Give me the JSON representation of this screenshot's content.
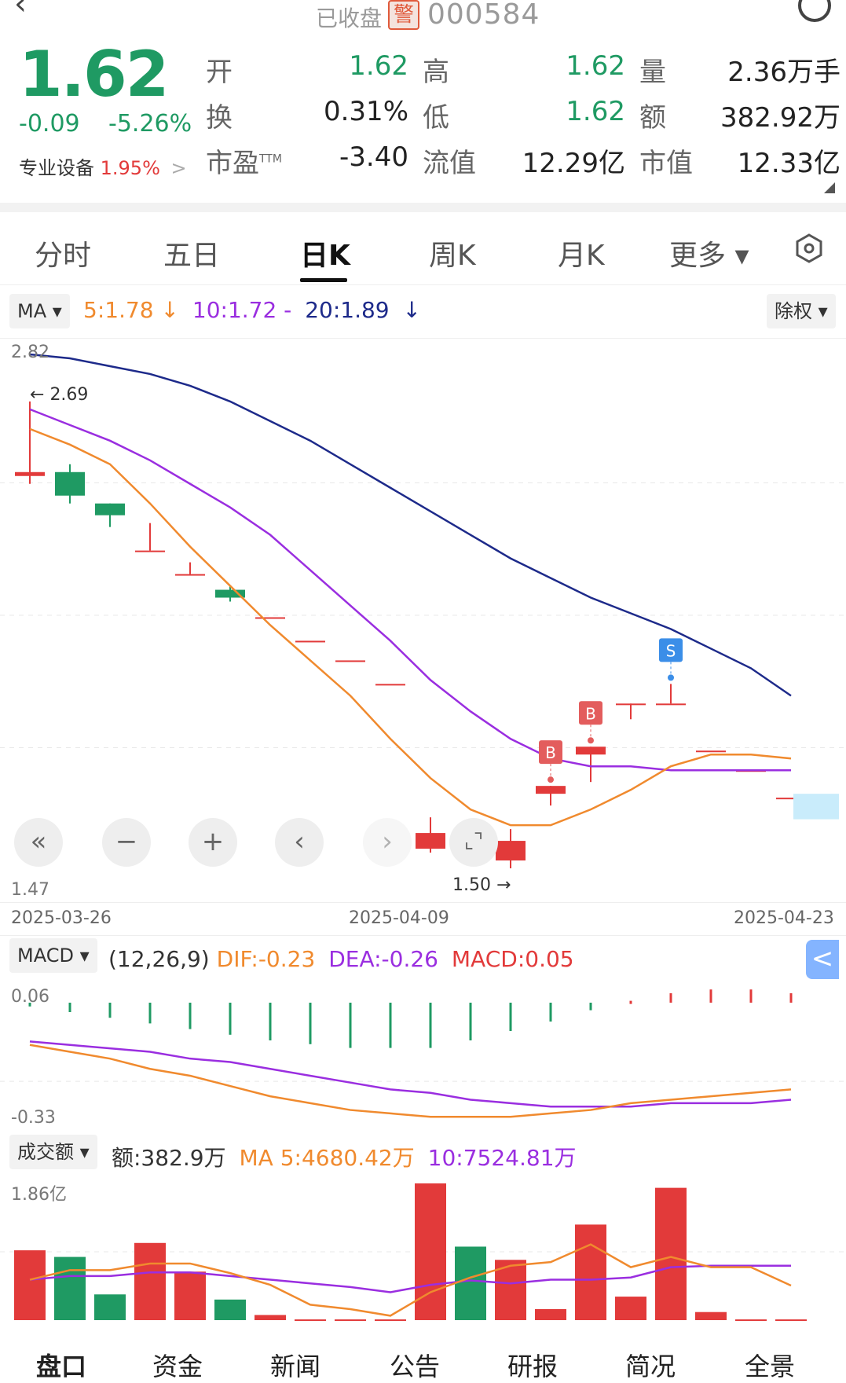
{
  "header": {
    "back_icon": "chevron-left-icon",
    "status": "已收盘",
    "warning_badge": "警",
    "code": "000584",
    "search_icon": "search-icon"
  },
  "quote": {
    "price": "1.62",
    "change": "-0.09",
    "change_pct": "-5.26%",
    "sector_label": "专业设备",
    "sector_pct": "1.95%",
    "sector_arrow": ">",
    "rows": [
      {
        "l1": "开",
        "v1": "1.62",
        "l2": "高",
        "v2": "1.62",
        "l3": "量",
        "v3": "2.36万手"
      },
      {
        "l1": "换",
        "v1": "0.31%",
        "l2": "低",
        "v2": "1.62",
        "l3": "额",
        "v3": "382.92万"
      },
      {
        "l1": "市盈",
        "sup": "TTM",
        "v1": "-3.40",
        "l2": "流值",
        "v2": "12.29亿",
        "l3": "市值",
        "v3": "12.33亿"
      }
    ]
  },
  "tabs": [
    "分时",
    "五日",
    "日K",
    "周K",
    "月K",
    "更多 ▾"
  ],
  "active_tab": "日K",
  "settings_icon": "hexagon-settings-icon",
  "ma": {
    "chip": "MA ▾",
    "ma5": "5:1.78",
    "ma5_arrow": "↓",
    "ma10": "10:1.72 -",
    "ma20": "20:1.89",
    "ma20_arrow": "↓",
    "adjust_chip": "除权 ▾"
  },
  "kline_axis": {
    "top": "2.82",
    "bottom": "1.47"
  },
  "annotations": {
    "high": "2.69",
    "low": "1.50"
  },
  "dates": {
    "start": "2025-03-26",
    "mid": "2025-04-09",
    "end": "2025-04-23"
  },
  "controls": {
    "first": "«",
    "zoom_out": "−",
    "zoom_in": "+",
    "prev": "‹",
    "next": "›"
  },
  "macd": {
    "chip": "MACD ▾",
    "params": "(12,26,9)",
    "dif": "DIF:-0.23",
    "dea": "DEA:-0.26",
    "macd": "MACD:0.05",
    "axis_top": "0.06",
    "axis_bottom": "-0.33",
    "side_toggle": "<"
  },
  "amount": {
    "chip": "成交额 ▾",
    "value": "额:382.9万",
    "ma5": "MA 5:4680.42万",
    "ma10": "10:7524.81万",
    "axis_top": "1.86亿"
  },
  "bottom_tabs": [
    "盘口",
    "资金",
    "新闻",
    "公告",
    "研报",
    "简况",
    "全景"
  ],
  "colors": {
    "up": "#e23a3a",
    "down": "#1f9a63",
    "ma5": "#f08a2e",
    "ma10": "#9a2ee0",
    "ma20": "#1d2a8a",
    "buy": "#e35d5d",
    "sell": "#3b8ee8"
  },
  "chart_data": {
    "type": "candlestick",
    "dates_shown": [
      "2025-03-26",
      "2025-04-09",
      "2025-04-23"
    ],
    "candles": [
      {
        "o": 2.5,
        "h": 2.69,
        "l": 2.48,
        "c": 2.51
      },
      {
        "o": 2.51,
        "h": 2.53,
        "l": 2.43,
        "c": 2.45
      },
      {
        "o": 2.43,
        "h": 2.42,
        "l": 2.37,
        "c": 2.4
      },
      {
        "o": 2.31,
        "h": 2.38,
        "l": 2.31,
        "c": 2.31
      },
      {
        "o": 2.25,
        "h": 2.28,
        "l": 2.25,
        "c": 2.25
      },
      {
        "o": 2.21,
        "h": 2.22,
        "l": 2.18,
        "c": 2.19
      },
      {
        "o": 2.14,
        "h": 2.14,
        "l": 2.14,
        "c": 2.14
      },
      {
        "o": 2.08,
        "h": 2.08,
        "l": 2.08,
        "c": 2.08
      },
      {
        "o": 2.03,
        "h": 2.03,
        "l": 2.03,
        "c": 2.03
      },
      {
        "o": 1.97,
        "h": 1.97,
        "l": 1.97,
        "c": 1.97
      },
      {
        "o": 1.55,
        "h": 1.63,
        "l": 1.54,
        "c": 1.59
      },
      {
        "o": 1.58,
        "h": 1.61,
        "l": 1.55,
        "c": 1.57
      },
      {
        "o": 1.52,
        "h": 1.6,
        "l": 1.5,
        "c": 1.57
      },
      {
        "o": 1.69,
        "h": 1.71,
        "l": 1.66,
        "c": 1.71
      },
      {
        "o": 1.79,
        "h": 1.81,
        "l": 1.72,
        "c": 1.81
      },
      {
        "o": 1.92,
        "h": 1.91,
        "l": 1.88,
        "c": 1.92
      },
      {
        "o": 1.92,
        "h": 1.97,
        "l": 1.92,
        "c": 1.92
      },
      {
        "o": 1.8,
        "h": 1.8,
        "l": 1.8,
        "c": 1.8
      },
      {
        "o": 1.75,
        "h": 1.75,
        "l": 1.75,
        "c": 1.75
      },
      {
        "o": 1.68,
        "h": 1.68,
        "l": 1.68,
        "c": 1.68
      }
    ],
    "ma5": [
      2.62,
      2.58,
      2.53,
      2.43,
      2.32,
      2.22,
      2.12,
      2.03,
      1.94,
      1.83,
      1.73,
      1.65,
      1.61,
      1.61,
      1.65,
      1.7,
      1.76,
      1.79,
      1.79,
      1.78
    ],
    "ma10": [
      2.67,
      2.63,
      2.59,
      2.54,
      2.48,
      2.42,
      2.35,
      2.26,
      2.17,
      2.08,
      1.98,
      1.9,
      1.83,
      1.78,
      1.76,
      1.76,
      1.75,
      1.75,
      1.75,
      1.75
    ],
    "ma20": [
      2.81,
      2.8,
      2.78,
      2.76,
      2.73,
      2.69,
      2.64,
      2.59,
      2.53,
      2.47,
      2.41,
      2.35,
      2.29,
      2.24,
      2.19,
      2.15,
      2.11,
      2.06,
      2.01,
      1.94
    ],
    "markers": [
      {
        "index": 13,
        "type": "B"
      },
      {
        "index": 14,
        "type": "B"
      },
      {
        "index": 16,
        "type": "S"
      }
    ],
    "macd": {
      "hist": [
        -0.02,
        -0.05,
        -0.08,
        -0.11,
        -0.14,
        -0.17,
        -0.2,
        -0.22,
        -0.24,
        -0.24,
        -0.24,
        -0.2,
        -0.15,
        -0.1,
        -0.04,
        0.01,
        0.05,
        0.07,
        0.07,
        0.05
      ],
      "dif": [
        -0.1,
        -0.12,
        -0.14,
        -0.17,
        -0.19,
        -0.22,
        -0.25,
        -0.27,
        -0.29,
        -0.3,
        -0.31,
        -0.31,
        -0.31,
        -0.3,
        -0.29,
        -0.27,
        -0.26,
        -0.25,
        -0.24,
        -0.23
      ],
      "dea": [
        -0.09,
        -0.1,
        -0.11,
        -0.12,
        -0.14,
        -0.15,
        -0.17,
        -0.19,
        -0.21,
        -0.23,
        -0.24,
        -0.26,
        -0.27,
        -0.28,
        -0.28,
        -0.28,
        -0.27,
        -0.27,
        -0.27,
        -0.26
      ]
    },
    "amount": {
      "values": [
        0.95,
        0.86,
        0.35,
        1.05,
        0.66,
        0.28,
        0.07,
        0.01,
        0.01,
        0.01,
        1.86,
        1.0,
        0.82,
        0.15,
        1.3,
        0.32,
        1.8,
        0.11,
        0.01,
        0.01
      ],
      "ma5": [
        0.55,
        0.68,
        0.68,
        0.77,
        0.77,
        0.64,
        0.48,
        0.21,
        0.15,
        0.06,
        0.38,
        0.58,
        0.74,
        0.79,
        1.03,
        0.72,
        0.86,
        0.72,
        0.72,
        0.47
      ],
      "ma10": [
        0.55,
        0.6,
        0.6,
        0.65,
        0.65,
        0.6,
        0.55,
        0.5,
        0.45,
        0.38,
        0.48,
        0.54,
        0.5,
        0.55,
        0.55,
        0.58,
        0.72,
        0.74,
        0.74,
        0.74
      ]
    }
  }
}
